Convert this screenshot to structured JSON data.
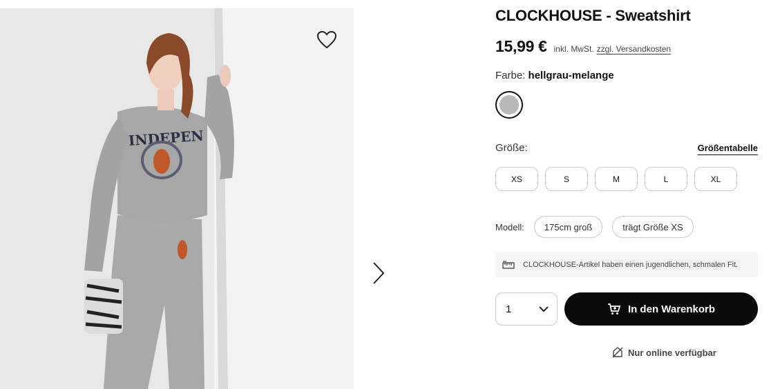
{
  "product": {
    "title": "CLOCKHOUSE - Sweatshirt",
    "price": "15,99 €",
    "tax_note": "inkl. MwSt.",
    "shipping_link": "zzgl. Versandkosten"
  },
  "color": {
    "label": "Farbe:",
    "selected": "hellgrau-melange",
    "swatch_color": "#b9b9b9"
  },
  "size": {
    "label": "Größe:",
    "table_link": "Größentabelle",
    "options": [
      "XS",
      "S",
      "M",
      "L",
      "XL"
    ]
  },
  "model": {
    "label": "Modell:",
    "height": "175cm groß",
    "size_worn": "trägt Größe XS"
  },
  "fit_note": {
    "icon": "ruler-icon",
    "text": "CLOCKHOUSE-Artikel haben einen jugendlichen, schmalen Fit."
  },
  "purchase": {
    "quantity": "1",
    "add_to_cart": "In den Warenkorb",
    "online_only": "Nur online verfügbar"
  },
  "icons": {
    "wishlist": "heart-icon",
    "next": "chevron-right-icon",
    "quantity_dropdown": "chevron-down-icon",
    "cart": "cart-icon",
    "online": "no-store-icon"
  },
  "colors": {
    "accent": "#0a0a0a",
    "note_bg": "#f6f5f1",
    "border": "#c9c9c9"
  }
}
